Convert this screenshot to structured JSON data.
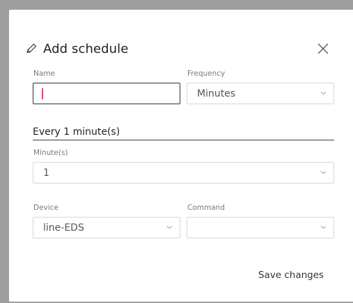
{
  "dialog": {
    "title": "Add schedule",
    "title_icon": "pencil-icon",
    "close_icon": "close-icon"
  },
  "form": {
    "name": {
      "label": "Name",
      "value": ""
    },
    "frequency": {
      "label": "Frequency",
      "value": "Minutes"
    },
    "summary": "Every 1 minute(s)",
    "minutes": {
      "label": "Minute(s)",
      "value": "1"
    },
    "device": {
      "label": "Device",
      "value": "line-EDS"
    },
    "command": {
      "label": "Command",
      "value": ""
    }
  },
  "actions": {
    "save_label": "Save changes"
  },
  "colors": {
    "caret": "#e2487a",
    "backdrop": "#9e9e9e"
  }
}
